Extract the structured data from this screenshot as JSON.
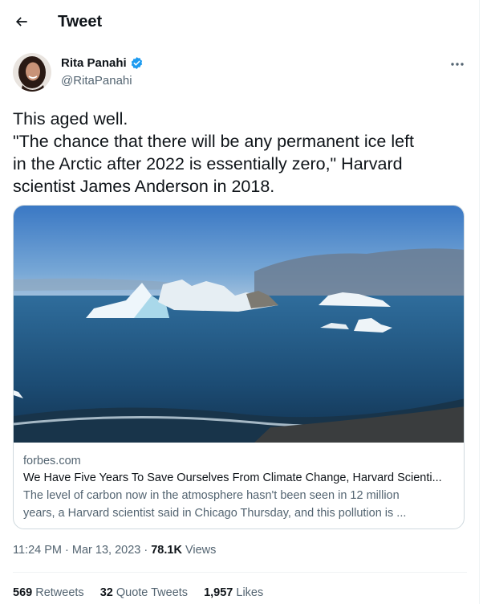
{
  "header": {
    "title": "Tweet"
  },
  "author": {
    "name": "Rita Panahi",
    "handle": "@RitaPanahi"
  },
  "tweet": {
    "lines": [
      "This aged well.",
      "\"The chance that there will be any permanent ice left",
      "in the Arctic after 2022 is essentially zero,\" Harvard",
      "scientist James Anderson in 2018."
    ]
  },
  "card": {
    "domain": "forbes.com",
    "title": "We Have Five Years To Save Ourselves From Climate Change, Harvard Scienti...",
    "description_lines": [
      "The level of carbon now in the atmosphere hasn't been seen in 12 million",
      "years, a Harvard scientist said in Chicago Thursday, and this pollution is ..."
    ]
  },
  "meta": {
    "time": "11:24 PM",
    "date": "Mar 13, 2023",
    "views_count": "78.1K",
    "views_label": "Views"
  },
  "stats": {
    "retweets_count": "569",
    "retweets_label": "Retweets",
    "quotes_count": "32",
    "quotes_label": "Quote Tweets",
    "likes_count": "1,957",
    "likes_label": "Likes"
  },
  "icons": {
    "back": "arrow-left-icon",
    "verified": "verified-badge-icon",
    "more": "more-icon"
  },
  "colors": {
    "verified": "#1d9bf0",
    "secondary_text": "#536471",
    "border": "#cfd9de"
  }
}
